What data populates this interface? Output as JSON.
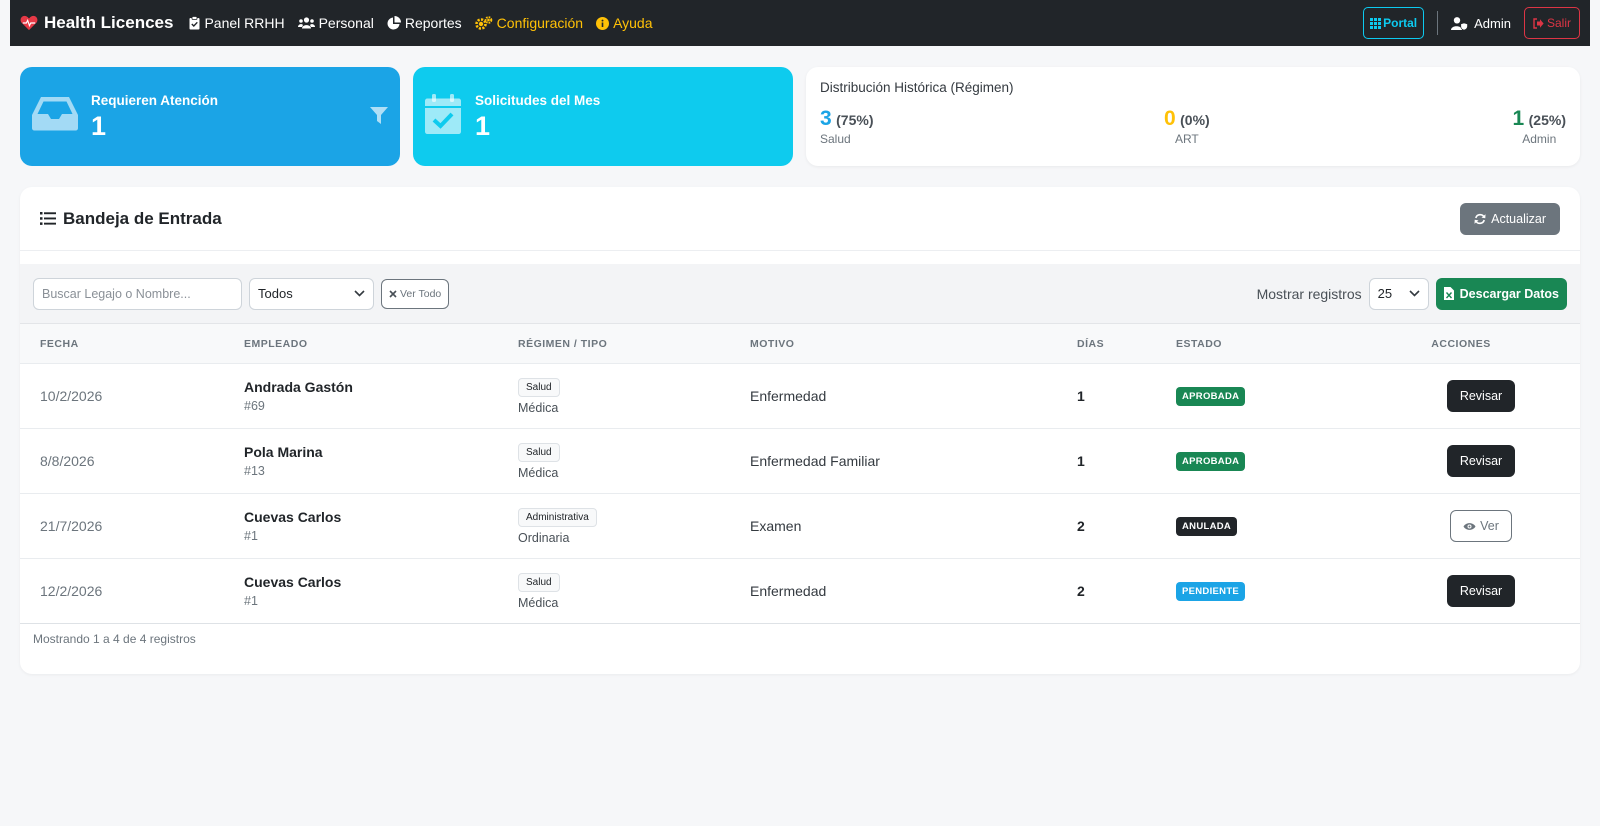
{
  "navbar": {
    "brand": "Health Licences",
    "items": [
      {
        "label": "Panel RRHH"
      },
      {
        "label": "Personal"
      },
      {
        "label": "Reportes"
      },
      {
        "label": "Configuración"
      },
      {
        "label": "Ayuda"
      }
    ],
    "portal_label": "Portal",
    "admin_label": "Admin",
    "salir_label": "Salir",
    "colors": {
      "bg": "#212529",
      "warn": "#ffc107",
      "portal": "#0dcaf0",
      "danger": "#dc3545"
    }
  },
  "stats": {
    "atencion": {
      "title": "Requieren Atención",
      "value": "1",
      "color": "#1ba4e6"
    },
    "mes": {
      "title": "Solicitudes del Mes",
      "value": "1",
      "color": "#0ecbee"
    },
    "distribucion": {
      "title": "Distribución Histórica (Régimen)",
      "salud": {
        "num": "3",
        "pct": "(75%)",
        "label": "Salud"
      },
      "art": {
        "num": "0",
        "pct": "(0%)",
        "label": "ART"
      },
      "admin": {
        "num": "1",
        "pct": "(25%)",
        "label": "Admin"
      }
    }
  },
  "inbox": {
    "title": "Bandeja de Entrada",
    "refresh_label": "Actualizar",
    "search_placeholder": "Buscar Legajo o Nombre...",
    "filter_selected": "Todos",
    "ver_todo_label": "Ver Todo",
    "mostrar_label": "Mostrar registros",
    "page_size": "25",
    "download_label": "Descargar Datos",
    "columns": {
      "fecha": "FECHA",
      "empleado": "EMPLEADO",
      "regimen": "RÉGIMEN / TIPO",
      "motivo": "MOTIVO",
      "dias": "DÍAS",
      "estado": "ESTADO",
      "acciones": "ACCIONES"
    },
    "rows": [
      {
        "fecha": "10/2/2026",
        "nombre": "Andrada Gastón",
        "legajo": "#69",
        "regimen": "Salud",
        "tipo": "Médica",
        "motivo": "Enfermedad",
        "dias": "1",
        "estado": "APROBADA",
        "accion": "Revisar"
      },
      {
        "fecha": "8/8/2026",
        "nombre": "Pola Marina",
        "legajo": "#13",
        "regimen": "Salud",
        "tipo": "Médica",
        "motivo": "Enfermedad Familiar",
        "dias": "1",
        "estado": "APROBADA",
        "accion": "Revisar"
      },
      {
        "fecha": "21/7/2026",
        "nombre": "Cuevas Carlos",
        "legajo": "#1",
        "regimen": "Administrativa",
        "tipo": "Ordinaria",
        "motivo": "Examen",
        "dias": "2",
        "estado": "ANULADA",
        "accion": "Ver"
      },
      {
        "fecha": "12/2/2026",
        "nombre": "Cuevas Carlos",
        "legajo": "#1",
        "regimen": "Salud",
        "tipo": "Médica",
        "motivo": "Enfermedad",
        "dias": "2",
        "estado": "PENDIENTE",
        "accion": "Revisar"
      }
    ],
    "footer": "Mostrando 1 a 4 de 4 registros"
  }
}
